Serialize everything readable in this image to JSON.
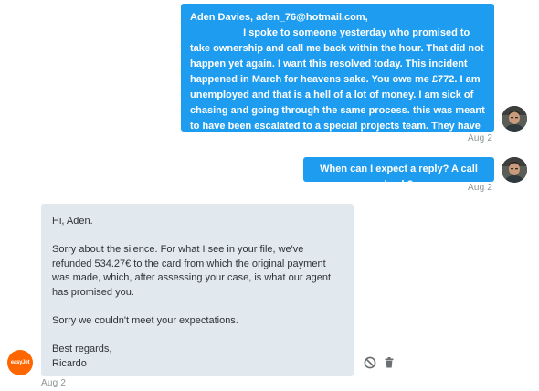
{
  "messages": [
    {
      "direction": "outgoing",
      "text": "Aden Davies, aden_76@hotmail.com,\n                   I spoke to someone yesterday who promised to take ownership and call me back within the hour. That did not happen yet again. I want this resolved today. This incident happened in March for heavens sake. You owe me £772. I am unemployed and that is a hell of a lot of money. I am sick of chasing and going through the same process. this was meant to have been escalated to a special projects team. They have done nothing.",
      "timestamp": "Aug 2",
      "avatar_icon": "user-photo-icon"
    },
    {
      "direction": "outgoing",
      "text": "When can I expect a reply? A call back?",
      "timestamp": "Aug 2",
      "avatar_icon": "user-photo-icon"
    },
    {
      "direction": "incoming",
      "text": "Hi, Aden.\n\nSorry about the silence. For what I see in your file, we've refunded 534.27€ to the card from which the original payment was made, which, after assessing your case, is what our agent has promised you.\n\nSorry we couldn't meet your expectations.\n\nBest regards,\nRicardo",
      "timestamp": "Aug 2",
      "avatar_label": "easyJet",
      "avatar_icon": "easyjet-logo-icon",
      "actions": [
        "hide-icon",
        "trash-icon"
      ]
    }
  ],
  "colors": {
    "outgoing_bubble": "#1e9cf0",
    "incoming_bubble": "#e1e8ee",
    "brand": "#ff6600",
    "timestamp": "#8c9396"
  }
}
